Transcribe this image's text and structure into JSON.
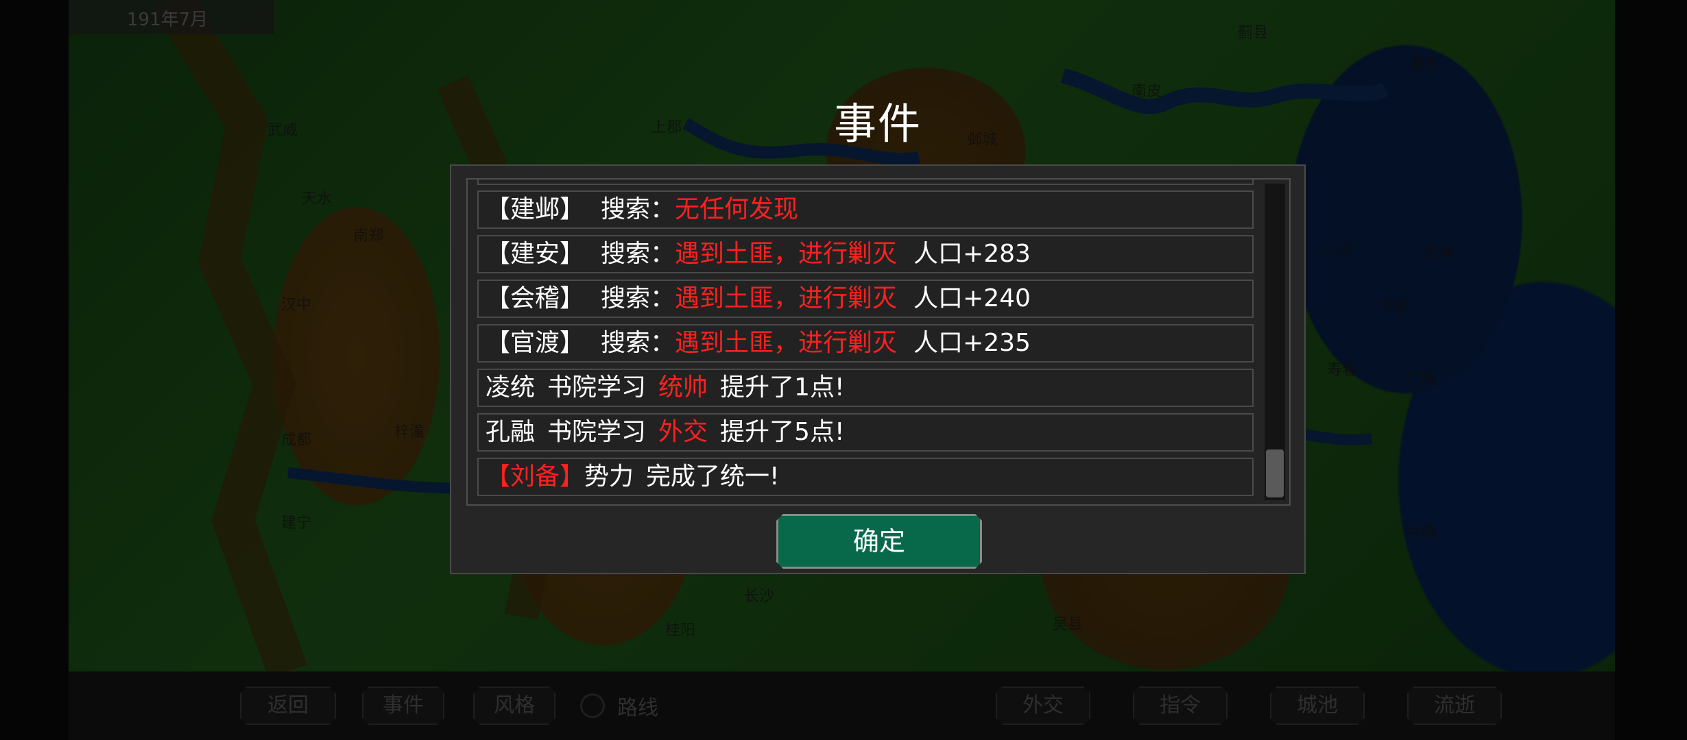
{
  "header": {
    "date": "191年7月"
  },
  "map": {
    "cities": [
      "蓟县",
      "襄平",
      "南皮",
      "武威",
      "上郡",
      "邺城",
      "天水",
      "南郑",
      "小沛",
      "北海",
      "汉中",
      "下邳",
      "梓潼",
      "寿春",
      "广陵",
      "成都",
      "建宁",
      "会稽",
      "长沙",
      "桂阳",
      "吴县"
    ]
  },
  "dialog": {
    "title": "事件",
    "events": [
      {
        "place": "【建邺】",
        "action": "搜索：",
        "result": "无任何发现",
        "extra": ""
      },
      {
        "place": "【建安】",
        "action": "搜索：",
        "result": "遇到土匪，进行剿灭",
        "extra": "人口+283"
      },
      {
        "place": "【会稽】",
        "action": "搜索：",
        "result": "遇到土匪，进行剿灭",
        "extra": "人口+240"
      },
      {
        "place": "【官渡】",
        "action": "搜索：",
        "result": "遇到土匪，进行剿灭",
        "extra": "人口+235"
      }
    ],
    "study": [
      {
        "person": "凌统",
        "activity": "书院学习",
        "stat": "统帅",
        "gain": "提升了1点!"
      },
      {
        "person": "孔融",
        "activity": "书院学习",
        "stat": "外交",
        "gain": "提升了5点!"
      }
    ],
    "unify": {
      "lord": "【刘备】",
      "faction": "势力",
      "msg": "完成了统一!"
    },
    "confirm": "确定"
  },
  "bottom_bar": {
    "back": "返回",
    "events": "事件",
    "style": "风格",
    "route": "路线",
    "diplomacy": "外交",
    "command": "指令",
    "cities": "城池",
    "passing": "流逝"
  }
}
